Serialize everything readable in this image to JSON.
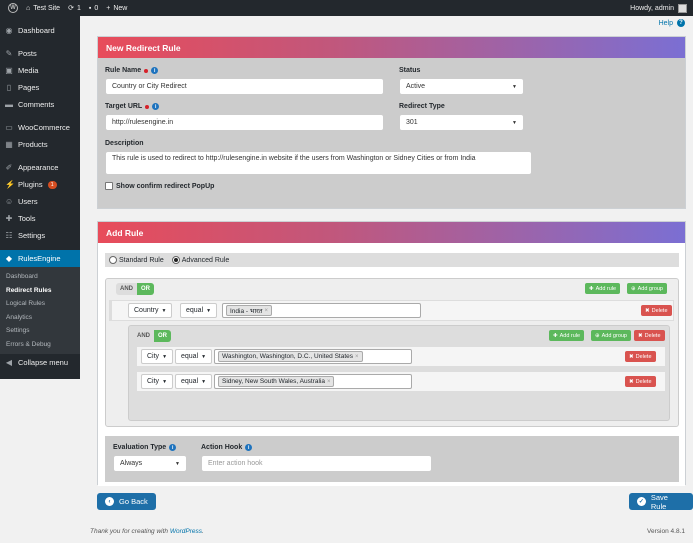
{
  "adminbar": {
    "site": "Test Site",
    "updates": "1",
    "comments": "0",
    "new_label": "New",
    "howdy": "Howdy, admin"
  },
  "sidebar": {
    "items": [
      {
        "label": "Dashboard",
        "icon": "dashboard-icon"
      },
      {
        "label": "Posts",
        "icon": "pin-icon"
      },
      {
        "label": "Media",
        "icon": "media-icon"
      },
      {
        "label": "Pages",
        "icon": "page-icon"
      },
      {
        "label": "Comments",
        "icon": "comment-icon"
      },
      {
        "label": "WooCommerce",
        "icon": "woo-icon"
      },
      {
        "label": "Products",
        "icon": "products-icon"
      },
      {
        "label": "Appearance",
        "icon": "brush-icon"
      },
      {
        "label": "Plugins",
        "icon": "plugin-icon",
        "badge": "1"
      },
      {
        "label": "Users",
        "icon": "users-icon"
      },
      {
        "label": "Tools",
        "icon": "wrench-icon"
      },
      {
        "label": "Settings",
        "icon": "settings-icon"
      },
      {
        "label": "RulesEngine",
        "icon": "rulesengine-icon"
      }
    ],
    "submenu": [
      "Dashboard",
      "Redirect Rules",
      "Logical Rules",
      "Analytics",
      "Settings",
      "Errors & Debug"
    ],
    "collapse": "Collapse menu"
  },
  "help": {
    "label": "Help",
    "icon": "?"
  },
  "new_rule": {
    "title": "New Redirect Rule",
    "rule_name_label": "Rule Name",
    "rule_name_value": "Country or City Redirect",
    "status_label": "Status",
    "status_value": "Active",
    "target_url_label": "Target URL",
    "target_url_value": "http://rulesengine.in",
    "redirect_type_label": "Redirect Type",
    "redirect_type_value": "301",
    "description_label": "Description",
    "description_value": "This rule is used to redirect to http://rulesengine.in website if the users from Washington or Sidney Cities or from India",
    "confirm_label": "Show confirm redirect PopUp"
  },
  "add_rule": {
    "title": "Add Rule",
    "standard": "Standard Rule",
    "advanced": "Advanced Rule",
    "and": "AND",
    "or": "OR",
    "add_rule": "Add rule",
    "add_group": "Add group",
    "delete": "Delete",
    "rule1": {
      "field": "Country",
      "op": "equal",
      "value": "India - भारत"
    },
    "rule2": {
      "field": "City",
      "op": "equal",
      "value": "Washington, Washington, D.C., United States"
    },
    "rule3": {
      "field": "City",
      "op": "equal",
      "value": "Sidney, New South Wales, Australia"
    },
    "eval_label": "Evaluation Type",
    "eval_value": "Always",
    "hook_label": "Action Hook",
    "hook_placeholder": "Enter action hook"
  },
  "buttons": {
    "back": "Go Back",
    "save": "Save Rule"
  },
  "footer": {
    "thanks": "Thank you for creating with ",
    "wp": "WordPress",
    "dot": ".",
    "version": "Version 4.8.1"
  }
}
